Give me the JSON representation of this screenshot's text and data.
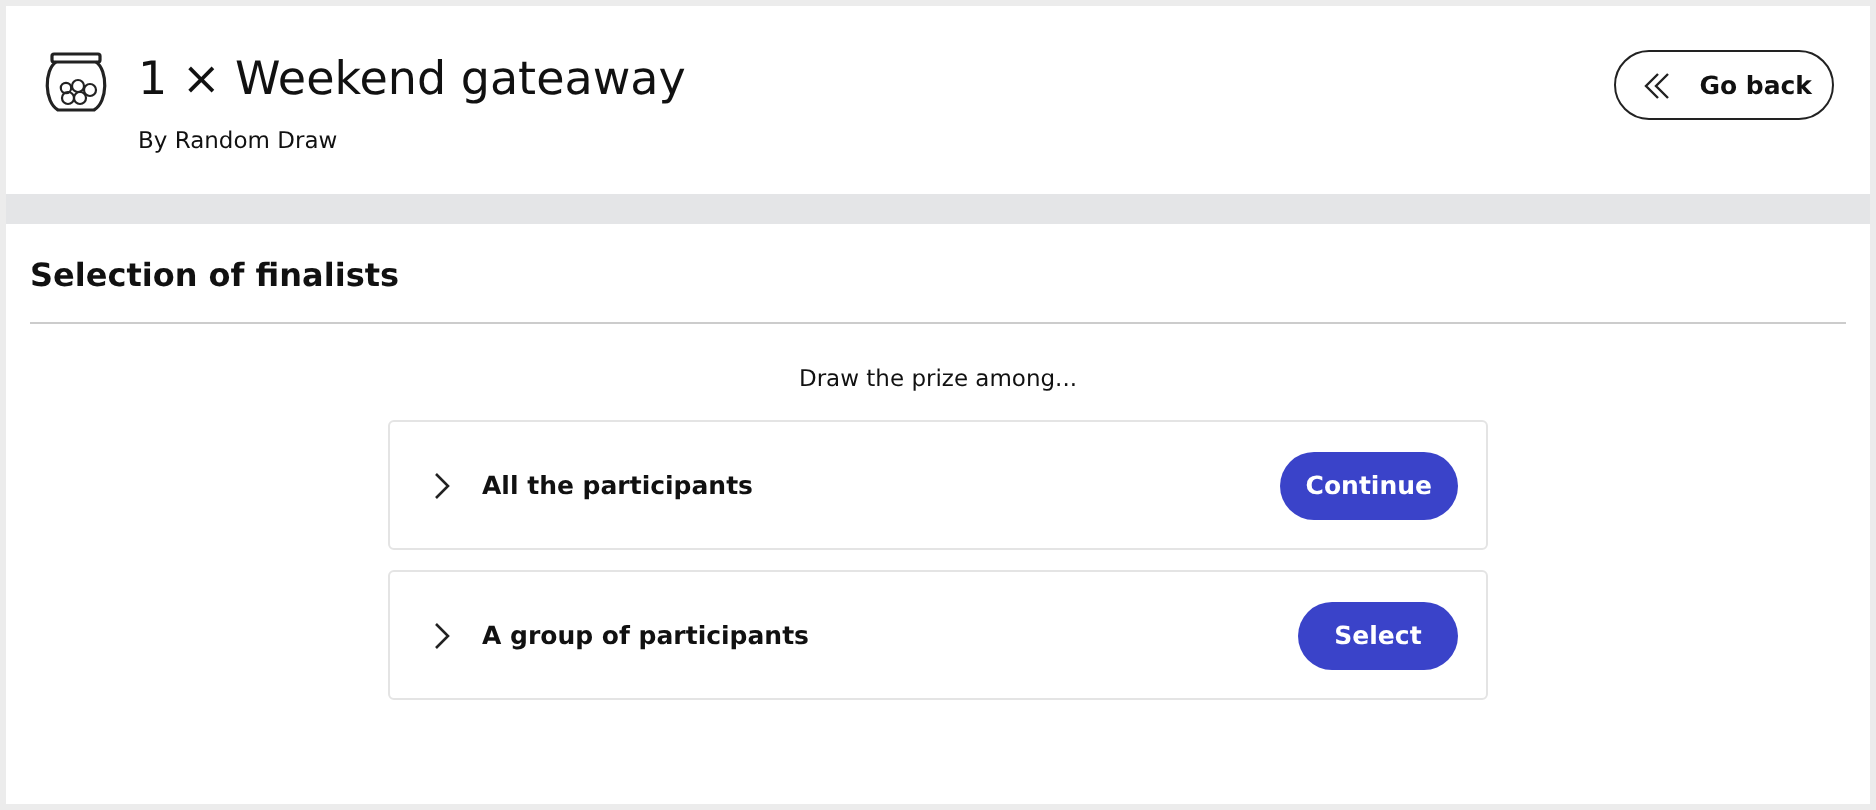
{
  "header": {
    "title": "1 × Weekend gateaway",
    "subtitle": "By Random Draw",
    "back_button": "Go back"
  },
  "section": {
    "title": "Selection of finalists",
    "prompt": "Draw the prize among...",
    "options": [
      {
        "label": "All the participants",
        "expanded": false,
        "action": "Continue"
      },
      {
        "label": "A group of participants",
        "expanded": false,
        "action": "Select"
      }
    ]
  }
}
